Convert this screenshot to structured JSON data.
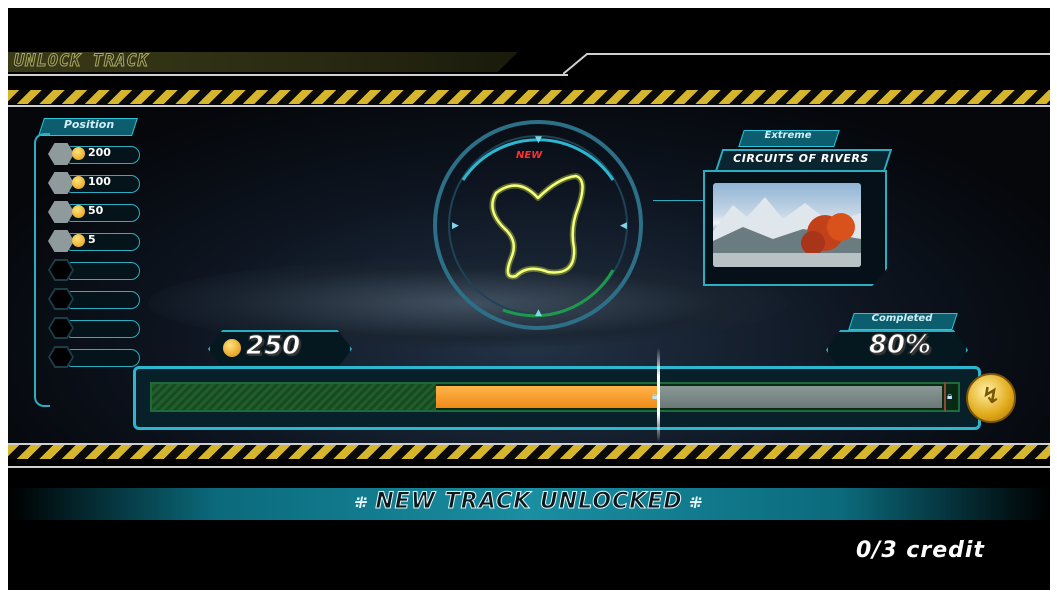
{
  "header": {
    "title": "UNLOCK TRACK"
  },
  "position_panel": {
    "label": "Position",
    "rows": [
      {
        "value": "200",
        "filled": true
      },
      {
        "value": "100",
        "filled": true
      },
      {
        "value": "50",
        "filled": true
      },
      {
        "value": "5",
        "filled": true
      },
      {
        "value": "",
        "filled": false
      },
      {
        "value": "",
        "filled": false
      },
      {
        "value": "",
        "filled": false
      },
      {
        "value": "",
        "filled": false
      }
    ]
  },
  "track": {
    "badge": "NEW",
    "difficulty": "Extreme",
    "name": "CIRCUITS OF RIVERS"
  },
  "coins": {
    "total": "250"
  },
  "completion": {
    "label": "Completed",
    "value": "80%"
  },
  "progress_bar": {
    "earned_fraction": 0.36,
    "new_fraction": 0.28
  },
  "message": {
    "text": "NEW TRACK UNLOCKED"
  },
  "credit": {
    "text": "0/3 credit"
  },
  "colors": {
    "accent": "#2bb7cf",
    "hazard": "#d6b62c",
    "progress": "#f08a18",
    "coin": "#e39a10"
  }
}
